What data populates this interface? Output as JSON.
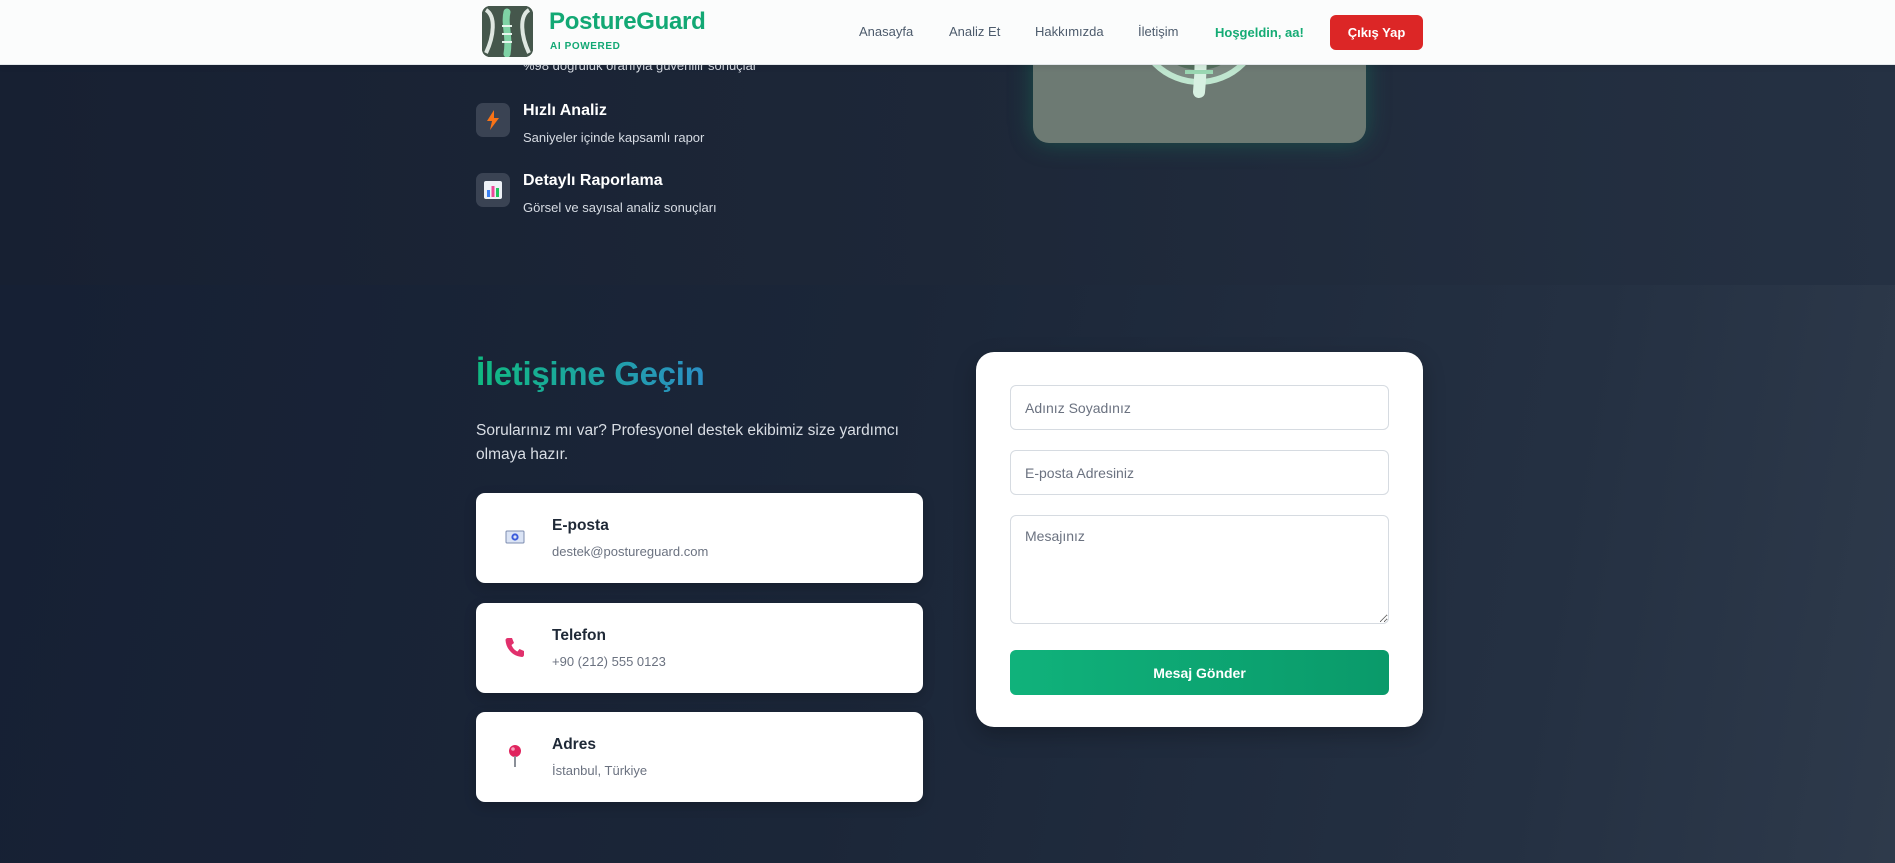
{
  "features": {
    "partial_desc": "%98 doğruluk oranıyla güvenilir sonuçlar",
    "items": [
      {
        "title": "Hızlı Analiz",
        "desc": "Saniyeler içinde kapsamlı rapor",
        "icon": "lightning-icon"
      },
      {
        "title": "Detaylı Raporlama",
        "desc": "Görsel ve sayısal analiz sonuçları",
        "icon": "bar-chart-icon"
      }
    ]
  },
  "navbar": {
    "brand_name": "PostureGuard",
    "brand_tag": "AI POWERED",
    "links": [
      "Anasayfa",
      "Analiz Et",
      "Hakkımızda",
      "İletişim"
    ],
    "welcome": "Hoşgeldin, aa!",
    "logout": "Çıkış Yap"
  },
  "contact": {
    "title": "İletişime Geçin",
    "lead": "Sorularınız mı var? Profesyonel destek ekibimiz size yardımcı olmaya hazır.",
    "cards": [
      {
        "title": "E-posta",
        "value": "destek@postureguard.com",
        "icon": "email-icon"
      },
      {
        "title": "Telefon",
        "value": "+90 (212) 555 0123",
        "icon": "phone-icon"
      },
      {
        "title": "Adres",
        "value": "İstanbul, Türkiye",
        "icon": "pin-icon"
      }
    ]
  },
  "form": {
    "name_placeholder": "Adınız Soyadınız",
    "email_placeholder": "E-posta Adresiniz",
    "message_placeholder": "Mesajınız",
    "submit": "Mesaj Gönder"
  },
  "colors": {
    "brand_green": "#12a874",
    "logout_red": "#dc2626",
    "page_bg": "#1b2536"
  }
}
